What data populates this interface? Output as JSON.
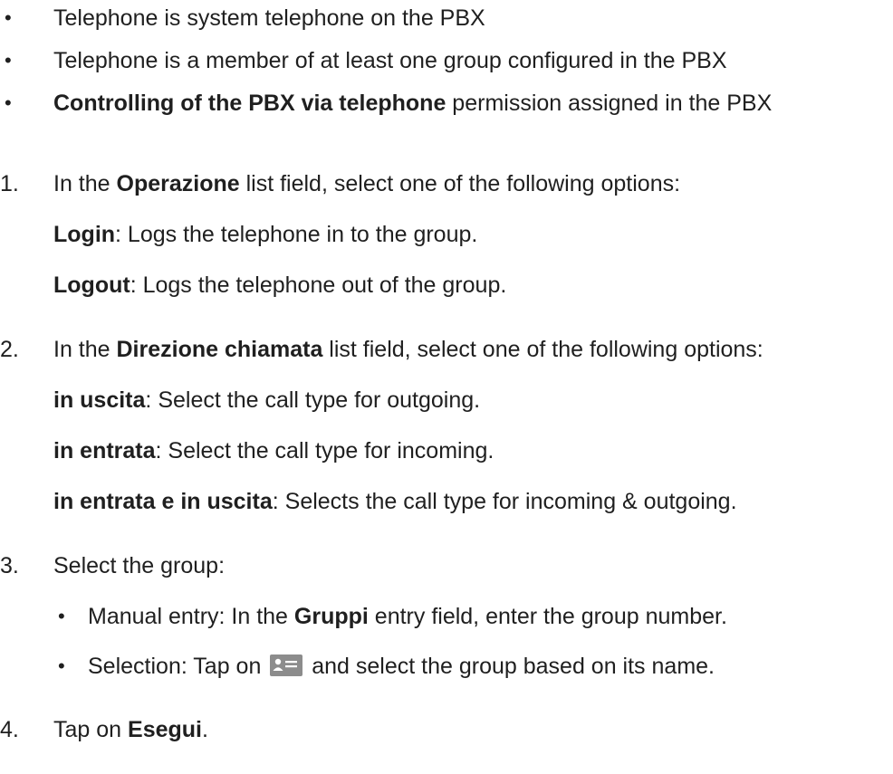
{
  "prereqs": [
    {
      "text": "Telephone is system telephone on the PBX"
    },
    {
      "text": "Telephone is a member of at least one group configured in the PBX"
    },
    {
      "bold": "Controlling of the PBX via telephone",
      "rest": " permission assigned in the PBX"
    }
  ],
  "steps": [
    {
      "num": "1.",
      "pre": "In the ",
      "bold": "Operazione",
      "post": " list field, select one of the following options:",
      "options": [
        {
          "bold": "Login",
          "rest": ": Logs the telephone in to the group."
        },
        {
          "bold": "Logout",
          "rest": ": Logs the telephone out of the group."
        }
      ]
    },
    {
      "num": "2.",
      "pre": "In the ",
      "bold": "Direzione chiamata",
      "post": " list field, select one of the following options:",
      "options": [
        {
          "bold": "in uscita",
          "rest": ": Select the call type for outgoing."
        },
        {
          "bold": "in entrata",
          "rest": ": Select the call type for incoming."
        },
        {
          "bold": "in entrata e in uscita",
          "rest": ": Selects the call type for incoming & outgoing."
        }
      ]
    },
    {
      "num": "3.",
      "text": "Select the group:",
      "subs": [
        {
          "pre": "Manual entry: In the ",
          "bold": "Gruppi",
          "post": " entry field, enter the group number."
        },
        {
          "pre": "Selection: Tap on ",
          "icon": "contacts-icon",
          "post": " and select the group based on its name."
        }
      ]
    },
    {
      "num": "4.",
      "pre": "Tap on ",
      "bold": "Esegui",
      "post": "."
    }
  ],
  "colors": {
    "text": "#1f1f1f",
    "icon_bg": "#8c8c8c",
    "icon_fg": "#ffffff"
  }
}
